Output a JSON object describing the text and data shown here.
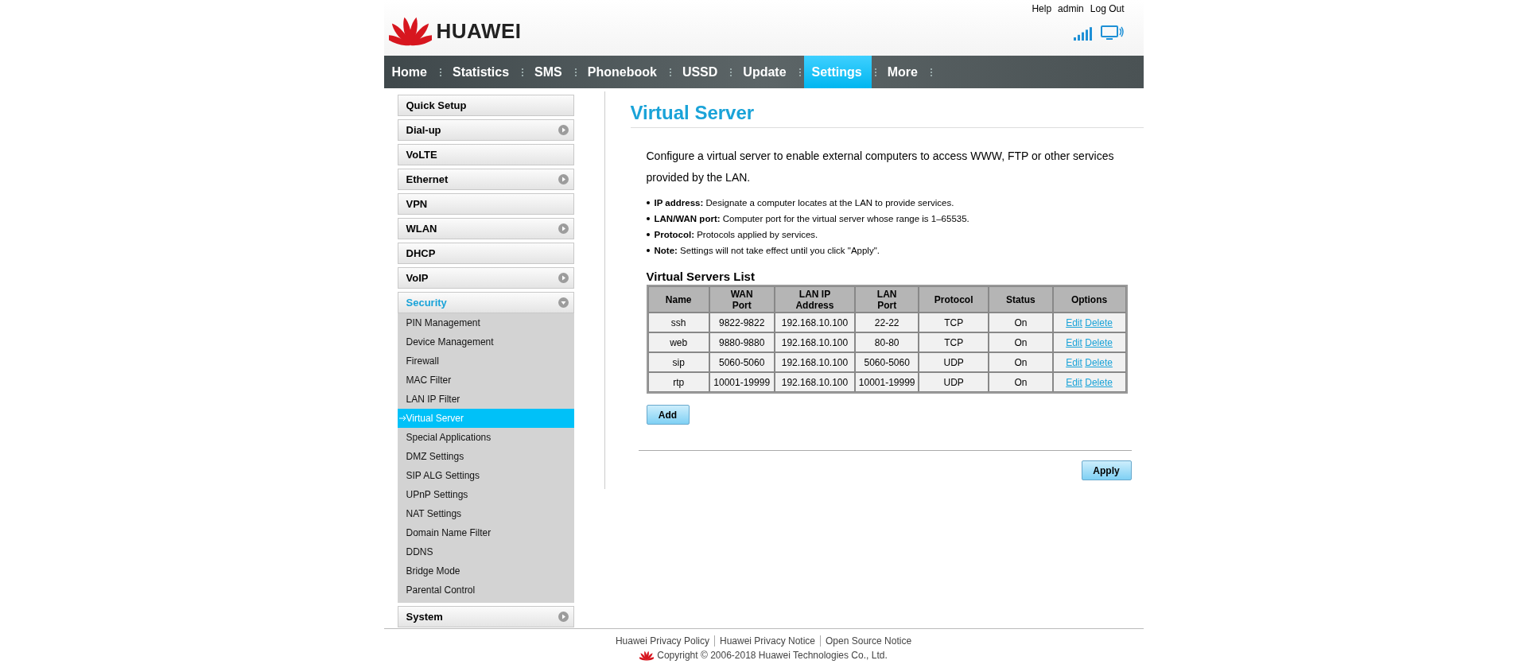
{
  "header": {
    "brand": "HUAWEI",
    "links": [
      "Help",
      "admin",
      "Log Out"
    ]
  },
  "nav": [
    {
      "label": "Home",
      "selected": false
    },
    {
      "label": "Statistics",
      "selected": false
    },
    {
      "label": "SMS",
      "selected": false
    },
    {
      "label": "Phonebook",
      "selected": false
    },
    {
      "label": "USSD",
      "selected": false
    },
    {
      "label": "Update",
      "selected": false
    },
    {
      "label": "Settings",
      "selected": true
    },
    {
      "label": "More",
      "selected": false
    }
  ],
  "sidebar": {
    "items": [
      {
        "label": "Quick Setup",
        "kind": "link",
        "expanded": false
      },
      {
        "label": "Dial-up",
        "kind": "group",
        "expanded": false
      },
      {
        "label": "VoLTE",
        "kind": "link",
        "expanded": false
      },
      {
        "label": "Ethernet",
        "kind": "group",
        "expanded": false
      },
      {
        "label": "VPN",
        "kind": "link",
        "expanded": false
      },
      {
        "label": "WLAN",
        "kind": "group",
        "expanded": false
      },
      {
        "label": "DHCP",
        "kind": "link",
        "expanded": false
      },
      {
        "label": "VoIP",
        "kind": "group",
        "expanded": false
      },
      {
        "label": "Security",
        "kind": "group",
        "expanded": true,
        "children": [
          {
            "label": "PIN Management",
            "selected": false
          },
          {
            "label": "Device Management",
            "selected": false
          },
          {
            "label": "Firewall",
            "selected": false
          },
          {
            "label": "MAC Filter",
            "selected": false
          },
          {
            "label": "LAN IP Filter",
            "selected": false
          },
          {
            "label": "Virtual Server",
            "selected": true
          },
          {
            "label": "Special Applications",
            "selected": false
          },
          {
            "label": "DMZ Settings",
            "selected": false
          },
          {
            "label": "SIP ALG Settings",
            "selected": false
          },
          {
            "label": "UPnP Settings",
            "selected": false
          },
          {
            "label": "NAT Settings",
            "selected": false
          },
          {
            "label": "Domain Name Filter",
            "selected": false
          },
          {
            "label": "DDNS",
            "selected": false
          },
          {
            "label": "Bridge Mode",
            "selected": false
          },
          {
            "label": "Parental Control",
            "selected": false
          }
        ]
      },
      {
        "label": "System",
        "kind": "group",
        "expanded": false
      }
    ]
  },
  "page": {
    "title": "Virtual Server",
    "intro": "Configure a virtual server to enable external computers to access WWW, FTP or other services provided by the LAN.",
    "notes": [
      "**IP address:**  Designate a computer locates at the LAN to provide services.",
      "**LAN/WAN port:**  Computer port for the virtual server whose range is 1–65535.",
      "**Protocol:**  Protocols applied by services.",
      "**Note:**  Settings will not take effect until you click \"Apply\"."
    ],
    "table": {
      "title": "Virtual Servers List",
      "columns": [
        "Name",
        "WAN Port",
        "LAN IP Address",
        "LAN Port",
        "Protocol",
        "Status",
        "Options"
      ],
      "rows": [
        {
          "cells": [
            "ssh",
            "9822-9822",
            "192.168.10.100",
            "22-22",
            "TCP",
            "On"
          ],
          "actions": [
            "Edit",
            "Delete"
          ]
        },
        {
          "cells": [
            "web",
            "9880-9880",
            "192.168.10.100",
            "80-80",
            "TCP",
            "On"
          ],
          "actions": [
            "Edit",
            "Delete"
          ]
        },
        {
          "cells": [
            "sip",
            "5060-5060",
            "192.168.10.100",
            "5060-5060",
            "UDP",
            "On"
          ],
          "actions": [
            "Edit",
            "Delete"
          ]
        },
        {
          "cells": [
            "rtp",
            "10001-19999",
            "192.168.10.100",
            "10001-19999",
            "UDP",
            "On"
          ],
          "actions": [
            "Edit",
            "Delete"
          ]
        }
      ]
    },
    "add_button": "Add",
    "apply_button": "Apply"
  },
  "footer": {
    "links": [
      "Huawei Privacy Policy",
      "Huawei Privacy Notice",
      "Open Source Notice"
    ],
    "copyright": "Copyright © 2006-2018 Huawei Technologies Co., Ltd."
  }
}
